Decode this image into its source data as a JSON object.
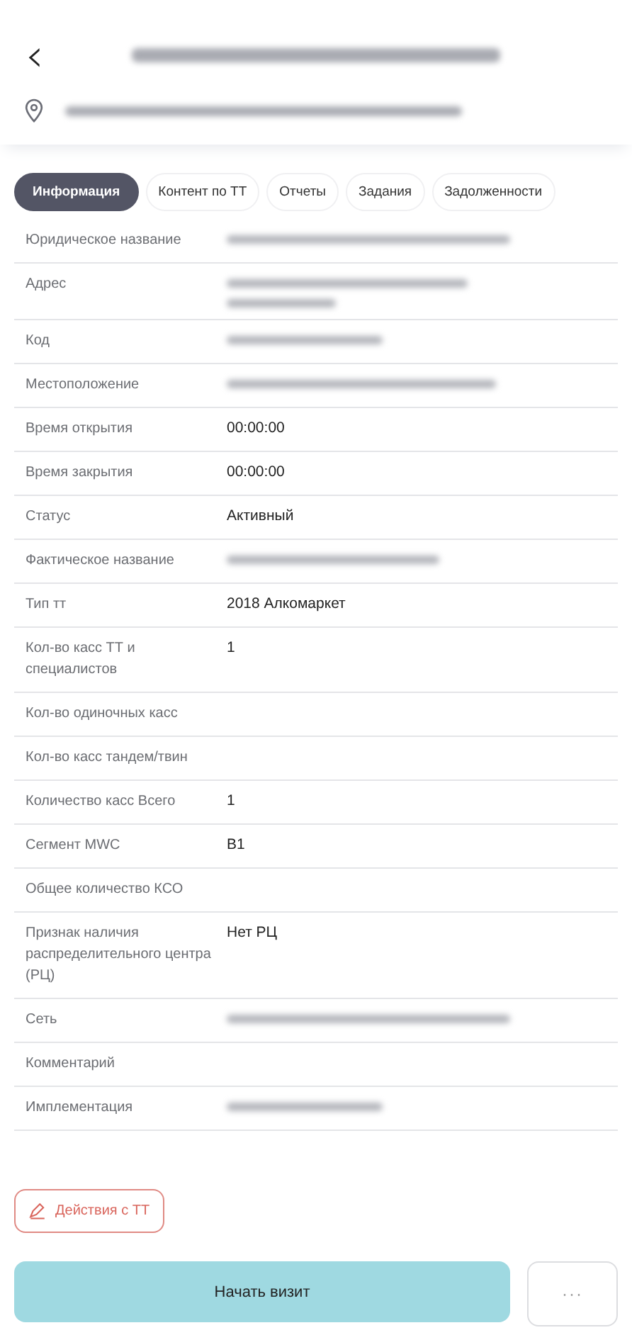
{
  "header": {
    "back_icon": "‹",
    "title": {
      "redacted": true
    },
    "address": {
      "redacted": true
    }
  },
  "tabs": [
    {
      "label": "Информация",
      "selected": true
    },
    {
      "label": "Контент по ТТ",
      "selected": false
    },
    {
      "label": "Отчеты",
      "selected": false
    },
    {
      "label": "Задания",
      "selected": false
    },
    {
      "label": "Задолженности",
      "selected": false
    }
  ],
  "fields": [
    {
      "label": "Юридическое название",
      "redacted": true,
      "wrapped": false
    },
    {
      "label": "Адрес",
      "redacted": true,
      "wrapped": true
    },
    {
      "label": "Код",
      "redacted": true,
      "wrapped": false
    },
    {
      "label": "Местоположение",
      "redacted": true,
      "wrapped": false
    },
    {
      "label": "Время открытия",
      "value": "00:00:00"
    },
    {
      "label": "Время закрытия",
      "value": "00:00:00"
    },
    {
      "label": "Статус",
      "value": "Активный"
    },
    {
      "label": "Фактическое название",
      "redacted": true,
      "wrapped": false
    },
    {
      "label": "Тип тт",
      "value": "2018 Алкомаркет"
    },
    {
      "label": "Кол-во касс ТТ и специалистов",
      "value": "1"
    },
    {
      "label": "Кол-во одиночных касс"
    },
    {
      "label": "Кол-во касс тандем/твин"
    },
    {
      "label": "Количество касс Всего",
      "value": "1"
    },
    {
      "label": "Сегмент MWC",
      "value": "B1"
    },
    {
      "label": "Общее количество КСО"
    },
    {
      "label": "Признак наличия распределительного центра (РЦ)",
      "value": "Нет РЦ"
    },
    {
      "label": "Сеть",
      "redacted": true,
      "wrapped": false
    },
    {
      "label": "Комментарий"
    },
    {
      "label": "Имплементация",
      "redacted": true,
      "wrapped": false
    }
  ],
  "actions_button": {
    "label": "Действия с ТТ"
  },
  "start_button": {
    "label": "Начать визит"
  },
  "more_button": {
    "label": "···"
  }
}
